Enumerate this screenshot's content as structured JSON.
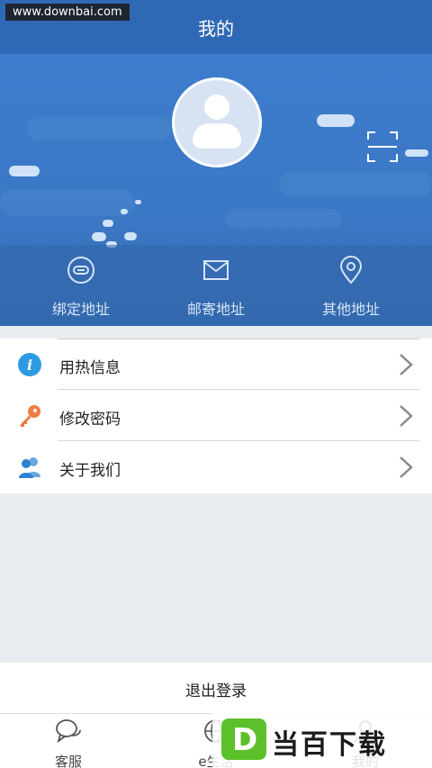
{
  "watermark_top": "www.downbai.com",
  "header": {
    "title": "我的"
  },
  "hero_actions": [
    {
      "label": "绑定地址",
      "icon": "link-icon"
    },
    {
      "label": "邮寄地址",
      "icon": "mail-icon"
    },
    {
      "label": "其他地址",
      "icon": "location-pin-icon"
    }
  ],
  "menu": [
    {
      "label": "用热信息",
      "icon": "info-icon",
      "color": "#2d9be0"
    },
    {
      "label": "修改密码",
      "icon": "key-icon",
      "color": "#ef7b45"
    },
    {
      "label": "关于我们",
      "icon": "users-icon",
      "color": "#2d9be0"
    }
  ],
  "logout": {
    "label": "退出登录"
  },
  "tabbar": [
    {
      "label": "客服",
      "icon": "chat-icon"
    },
    {
      "label": "e生活",
      "icon": "globe-icon"
    },
    {
      "label": "我的",
      "icon": "user-icon"
    }
  ],
  "watermark_brand": {
    "letter": "D",
    "text": "当百下载"
  },
  "colors": {
    "header_blue": "#2f69b5",
    "hero_blue": "#3b78c6",
    "background": "#e9ecf1"
  }
}
